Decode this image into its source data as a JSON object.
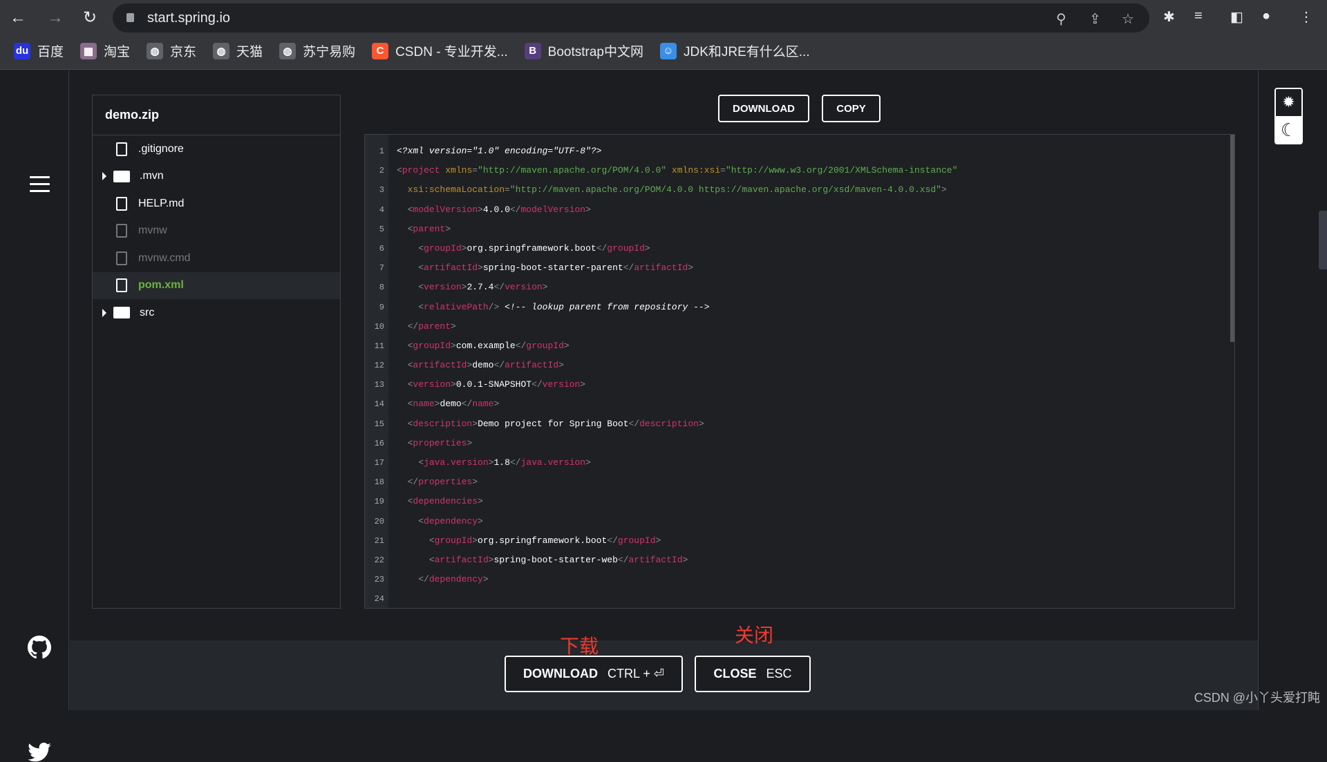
{
  "browser": {
    "url": "start.spring.io",
    "bookmarks": [
      {
        "label": "百度",
        "color": "#2932e1",
        "glyph": "du"
      },
      {
        "label": "淘宝",
        "color": "#8a6d8a",
        "glyph": "▦"
      },
      {
        "label": "京东",
        "color": "#5f6368",
        "glyph": "◍"
      },
      {
        "label": "天猫",
        "color": "#5f6368",
        "glyph": "◍"
      },
      {
        "label": "苏宁易购",
        "color": "#5f6368",
        "glyph": "◍"
      },
      {
        "label": "CSDN - 专业开发...",
        "color": "#fc5531",
        "glyph": "C"
      },
      {
        "label": "Bootstrap中文网",
        "color": "#563d7c",
        "glyph": "B"
      },
      {
        "label": "JDK和JRE有什么区...",
        "color": "#3a8ee6",
        "glyph": "☺"
      }
    ]
  },
  "explorer": {
    "title": "demo.zip",
    "items": [
      {
        "name": ".gitignore",
        "type": "file",
        "state": "normal"
      },
      {
        "name": ".mvn",
        "type": "folder",
        "state": "normal"
      },
      {
        "name": "HELP.md",
        "type": "file",
        "state": "normal"
      },
      {
        "name": "mvnw",
        "type": "file",
        "state": "dim"
      },
      {
        "name": "mvnw.cmd",
        "type": "file",
        "state": "dim"
      },
      {
        "name": "pom.xml",
        "type": "file",
        "state": "selected"
      },
      {
        "name": "src",
        "type": "folder",
        "state": "normal"
      }
    ]
  },
  "toolbar": {
    "download": "DOWNLOAD",
    "copy": "COPY"
  },
  "code": {
    "lines": [
      [
        [
          "c",
          "<?xml version=\"1.0\" encoding=\"UTF-8\"?>"
        ]
      ],
      [
        [
          "p",
          "<"
        ],
        [
          "t",
          "project"
        ],
        [
          "x",
          " "
        ],
        [
          "a",
          "xmlns"
        ],
        [
          "p",
          "="
        ],
        [
          "s",
          "\"http://maven.apache.org/POM/4.0.0\""
        ],
        [
          "x",
          " "
        ],
        [
          "a",
          "xmlns:xsi"
        ],
        [
          "p",
          "="
        ],
        [
          "s",
          "\"http://www.w3.org/2001/XMLSchema-instance\""
        ]
      ],
      [
        [
          "x",
          "  "
        ],
        [
          "a",
          "xsi:schemaLocation"
        ],
        [
          "p",
          "="
        ],
        [
          "s",
          "\"http://maven.apache.org/POM/4.0.0 https://maven.apache.org/xsd/maven-4.0.0.xsd\""
        ],
        [
          "p",
          ">"
        ]
      ],
      [
        [
          "x",
          "  "
        ],
        [
          "p",
          "<"
        ],
        [
          "t",
          "modelVersion"
        ],
        [
          "p",
          ">"
        ],
        [
          "x",
          "4.0.0"
        ],
        [
          "p",
          "</"
        ],
        [
          "t",
          "modelVersion"
        ],
        [
          "p",
          ">"
        ]
      ],
      [
        [
          "x",
          "  "
        ],
        [
          "p",
          "<"
        ],
        [
          "t",
          "parent"
        ],
        [
          "p",
          ">"
        ]
      ],
      [
        [
          "x",
          "    "
        ],
        [
          "p",
          "<"
        ],
        [
          "t",
          "groupId"
        ],
        [
          "p",
          ">"
        ],
        [
          "x",
          "org.springframework.boot"
        ],
        [
          "p",
          "</"
        ],
        [
          "t",
          "groupId"
        ],
        [
          "p",
          ">"
        ]
      ],
      [
        [
          "x",
          "    "
        ],
        [
          "p",
          "<"
        ],
        [
          "t",
          "artifactId"
        ],
        [
          "p",
          ">"
        ],
        [
          "x",
          "spring-boot-starter-parent"
        ],
        [
          "p",
          "</"
        ],
        [
          "t",
          "artifactId"
        ],
        [
          "p",
          ">"
        ]
      ],
      [
        [
          "x",
          "    "
        ],
        [
          "p",
          "<"
        ],
        [
          "t",
          "version"
        ],
        [
          "p",
          ">"
        ],
        [
          "x",
          "2.7.4"
        ],
        [
          "p",
          "</"
        ],
        [
          "t",
          "version"
        ],
        [
          "p",
          ">"
        ]
      ],
      [
        [
          "x",
          "    "
        ],
        [
          "p",
          "<"
        ],
        [
          "t",
          "relativePath"
        ],
        [
          "p",
          "/>"
        ],
        [
          "x",
          " "
        ],
        [
          "c",
          "<!-- lookup parent from repository -->"
        ]
      ],
      [
        [
          "x",
          "  "
        ],
        [
          "p",
          "</"
        ],
        [
          "t",
          "parent"
        ],
        [
          "p",
          ">"
        ]
      ],
      [
        [
          "x",
          "  "
        ],
        [
          "p",
          "<"
        ],
        [
          "t",
          "groupId"
        ],
        [
          "p",
          ">"
        ],
        [
          "x",
          "com.example"
        ],
        [
          "p",
          "</"
        ],
        [
          "t",
          "groupId"
        ],
        [
          "p",
          ">"
        ]
      ],
      [
        [
          "x",
          "  "
        ],
        [
          "p",
          "<"
        ],
        [
          "t",
          "artifactId"
        ],
        [
          "p",
          ">"
        ],
        [
          "x",
          "demo"
        ],
        [
          "p",
          "</"
        ],
        [
          "t",
          "artifactId"
        ],
        [
          "p",
          ">"
        ]
      ],
      [
        [
          "x",
          "  "
        ],
        [
          "p",
          "<"
        ],
        [
          "t",
          "version"
        ],
        [
          "p",
          ">"
        ],
        [
          "x",
          "0.0.1-SNAPSHOT"
        ],
        [
          "p",
          "</"
        ],
        [
          "t",
          "version"
        ],
        [
          "p",
          ">"
        ]
      ],
      [
        [
          "x",
          "  "
        ],
        [
          "p",
          "<"
        ],
        [
          "t",
          "name"
        ],
        [
          "p",
          ">"
        ],
        [
          "x",
          "demo"
        ],
        [
          "p",
          "</"
        ],
        [
          "t",
          "name"
        ],
        [
          "p",
          ">"
        ]
      ],
      [
        [
          "x",
          "  "
        ],
        [
          "p",
          "<"
        ],
        [
          "t",
          "description"
        ],
        [
          "p",
          ">"
        ],
        [
          "x",
          "Demo project for Spring Boot"
        ],
        [
          "p",
          "</"
        ],
        [
          "t",
          "description"
        ],
        [
          "p",
          ">"
        ]
      ],
      [
        [
          "x",
          "  "
        ],
        [
          "p",
          "<"
        ],
        [
          "t",
          "properties"
        ],
        [
          "p",
          ">"
        ]
      ],
      [
        [
          "x",
          "    "
        ],
        [
          "p",
          "<"
        ],
        [
          "t",
          "java.version"
        ],
        [
          "p",
          ">"
        ],
        [
          "x",
          "1.8"
        ],
        [
          "p",
          "</"
        ],
        [
          "t",
          "java.version"
        ],
        [
          "p",
          ">"
        ]
      ],
      [
        [
          "x",
          "  "
        ],
        [
          "p",
          "</"
        ],
        [
          "t",
          "properties"
        ],
        [
          "p",
          ">"
        ]
      ],
      [
        [
          "x",
          "  "
        ],
        [
          "p",
          "<"
        ],
        [
          "t",
          "dependencies"
        ],
        [
          "p",
          ">"
        ]
      ],
      [
        [
          "x",
          "    "
        ],
        [
          "p",
          "<"
        ],
        [
          "t",
          "dependency"
        ],
        [
          "p",
          ">"
        ]
      ],
      [
        [
          "x",
          "      "
        ],
        [
          "p",
          "<"
        ],
        [
          "t",
          "groupId"
        ],
        [
          "p",
          ">"
        ],
        [
          "x",
          "org.springframework.boot"
        ],
        [
          "p",
          "</"
        ],
        [
          "t",
          "groupId"
        ],
        [
          "p",
          ">"
        ]
      ],
      [
        [
          "x",
          "      "
        ],
        [
          "p",
          "<"
        ],
        [
          "t",
          "artifactId"
        ],
        [
          "p",
          ">"
        ],
        [
          "x",
          "spring-boot-starter-web"
        ],
        [
          "p",
          "</"
        ],
        [
          "t",
          "artifactId"
        ],
        [
          "p",
          ">"
        ]
      ],
      [
        [
          "x",
          "    "
        ],
        [
          "p",
          "</"
        ],
        [
          "t",
          "dependency"
        ],
        [
          "p",
          ">"
        ]
      ],
      []
    ]
  },
  "footer": {
    "download_label": "DOWNLOAD",
    "download_shortcut": "CTRL + ⏎",
    "close_label": "CLOSE",
    "close_shortcut": "ESC"
  },
  "annotations": {
    "download": "下载",
    "close": "关闭"
  },
  "watermark": "CSDN @小丫头爱打盹"
}
